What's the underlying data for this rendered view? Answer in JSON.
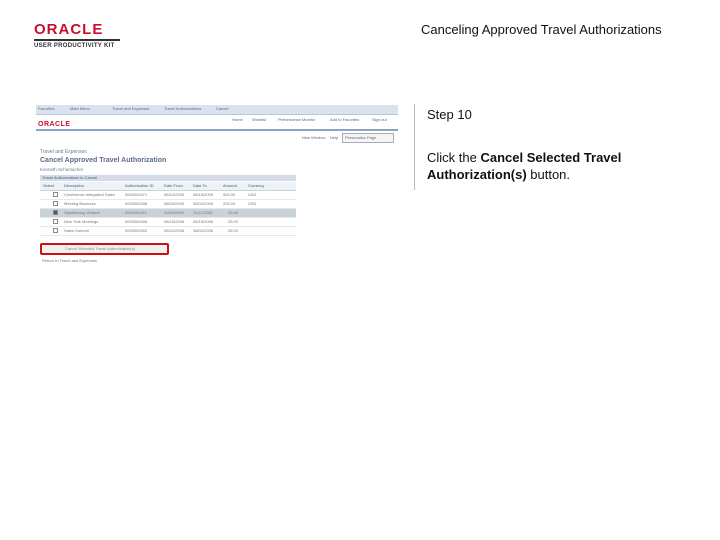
{
  "doc": {
    "title": "Canceling Approved Travel Authorizations",
    "step": "Step 10",
    "instruction_prefix": "Click the ",
    "instruction_bold": "Cancel Selected Travel Authorization(s)",
    "instruction_suffix": " button."
  },
  "logo": {
    "word": "ORACLE",
    "sub": "USER PRODUCTIVITY KIT"
  },
  "screenshot": {
    "logo": "ORACLE",
    "topbar": [
      "Favorites",
      "Main Menu",
      "Travel and Expenses",
      "Travel Authorizations",
      "Cancel"
    ],
    "nav": [
      "Home",
      "Worklist",
      "Performance Monitor",
      "Add to Favorites",
      "Sign out"
    ],
    "util": [
      "New Window",
      "Help",
      "Personalize Page"
    ],
    "breadcrumb": "Travel and Expenses",
    "page_title": "Cancel Approved Travel Authorization",
    "subtitle": "Kenneth Schumacher",
    "grid_title": "Travel Authorizations to Cancel",
    "columns": [
      "Select",
      "Description",
      "Authorization ID",
      "Date From",
      "Date To",
      "Amount",
      "Currency"
    ],
    "rows": [
      {
        "desc": "Conference Integrated Sales",
        "id": "0000000471",
        "from": "08/10/2009",
        "to": "08/16/2009",
        "amt": "500.00",
        "cur": "USD",
        "selected": false
      },
      {
        "desc": "Meeting Business",
        "id": "0000000436",
        "from": "08/04/2009",
        "to": "08/04/2009",
        "amt": "200.00",
        "cur": "USD",
        "selected": false
      },
      {
        "desc": "Sightseeing Venture",
        "id": "0000000411",
        "from": "11/09/2008",
        "to": "11/11/2008",
        "amt": "25.00",
        "cur": "",
        "selected": true
      },
      {
        "desc": "New York Meetings",
        "id": "0000000406",
        "from": "08/15/2008",
        "to": "08/15/2008",
        "amt": "25.00",
        "cur": "",
        "selected": false
      },
      {
        "desc": "Sales Summit",
        "id": "0000000402",
        "from": "08/02/2008",
        "to": "08/02/2008",
        "amt": "25.00",
        "cur": "",
        "selected": false
      }
    ],
    "cancel_button": "Cancel Selected Travel Authorization(s)",
    "return_link": "Return to Travel and Expenses"
  }
}
